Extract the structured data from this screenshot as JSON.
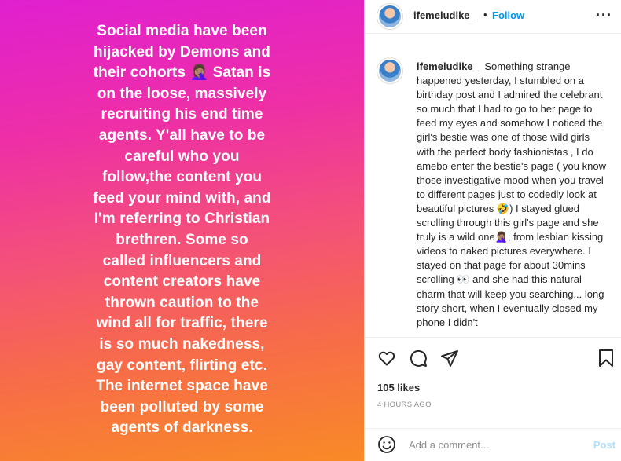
{
  "story": {
    "text": "Social media have been\nhijacked by Demons and\ntheir cohorts 🤦🏽‍♀️ Satan is\non the loose, massively\nrecruiting his end time\nagents. Y'all have to be\ncareful who you\nfollow,the content you\nfeed your mind with, and\nI'm referring to Christian\nbrethren. Some so\ncalled influencers and\ncontent creators have\nthrown caution to the\nwind all for traffic, there\nis so much nakedness,\ngay content, flirting etc.\nThe internet space have\nbeen polluted by some\nagents of darkness."
  },
  "header": {
    "username": "ifemeludike_",
    "separator": "•",
    "follow_label": "Follow",
    "more_icon": "more-horizontal-icon"
  },
  "caption": {
    "username": "ifemeludike_",
    "text": "Something strange happened yesterday, I stumbled on a birthday post and I admired the celebrant so much that I had to go to her page to feed my eyes and somehow I noticed the girl's bestie was one of those wild girls with the perfect body fashionistas , I do amebo enter the bestie's page ( you know those investigative mood when you travel to different pages just to codedly look at beautiful pictures 🤣) I stayed glued scrolling through this girl's page and she truly is a wild one🤦🏽‍♀️, from lesbian kissing videos to naked pictures everywhere. I stayed on that page for about 30mins scrolling 👀 and she had this natural charm that will keep you searching... long story short, when I eventually closed my phone I didn't"
  },
  "actions": {
    "icons": [
      "heart-icon",
      "comment-icon",
      "share-icon",
      "bookmark-icon"
    ],
    "likes": "105 likes",
    "time": "4 HOURS AGO"
  },
  "comment": {
    "placeholder": "Add a comment...",
    "post_label": "Post",
    "emoji_icon": "smiley-icon"
  }
}
